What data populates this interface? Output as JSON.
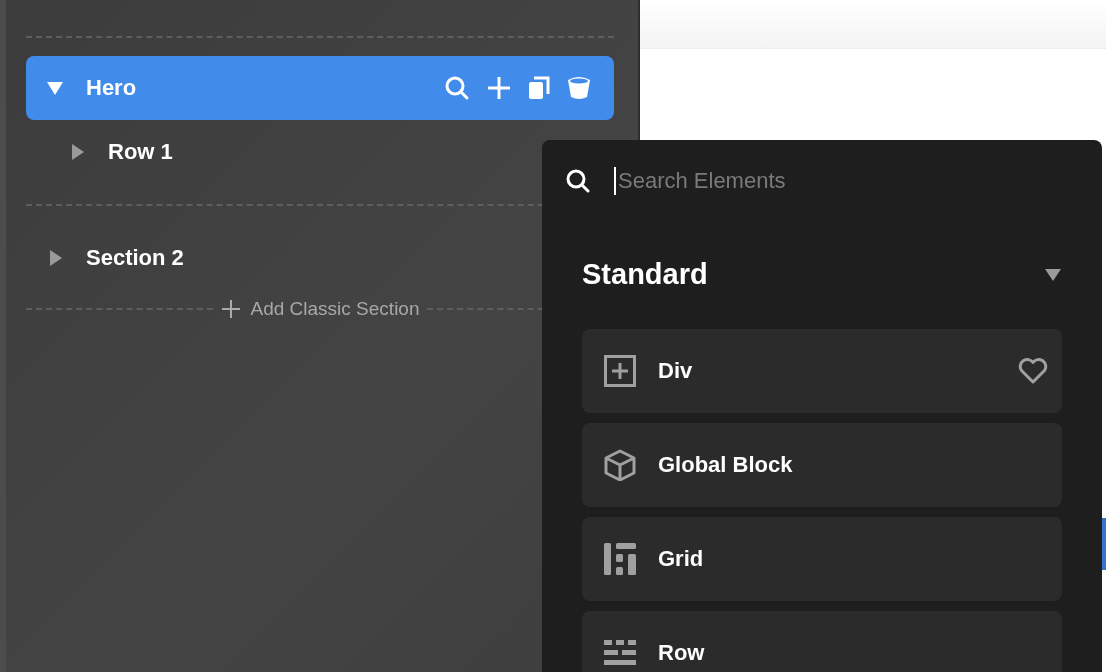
{
  "tree": {
    "sections": [
      {
        "label": "Hero",
        "expanded": true,
        "selected": true,
        "children": [
          {
            "label": "Row 1",
            "expanded": false
          }
        ]
      },
      {
        "label": "Section 2",
        "expanded": false,
        "selected": false
      }
    ],
    "add_section": "Add Classic Section"
  },
  "element_picker": {
    "search": {
      "placeholder": "Search Elements"
    },
    "category": {
      "title": "Standard",
      "expanded": true
    },
    "elements": [
      {
        "label": "Div",
        "kind": "div",
        "show_favorite": true
      },
      {
        "label": "Global Block",
        "kind": "global-block",
        "show_favorite": false
      },
      {
        "label": "Grid",
        "kind": "grid",
        "show_favorite": false
      },
      {
        "label": "Row",
        "kind": "row",
        "show_favorite": false
      }
    ]
  }
}
